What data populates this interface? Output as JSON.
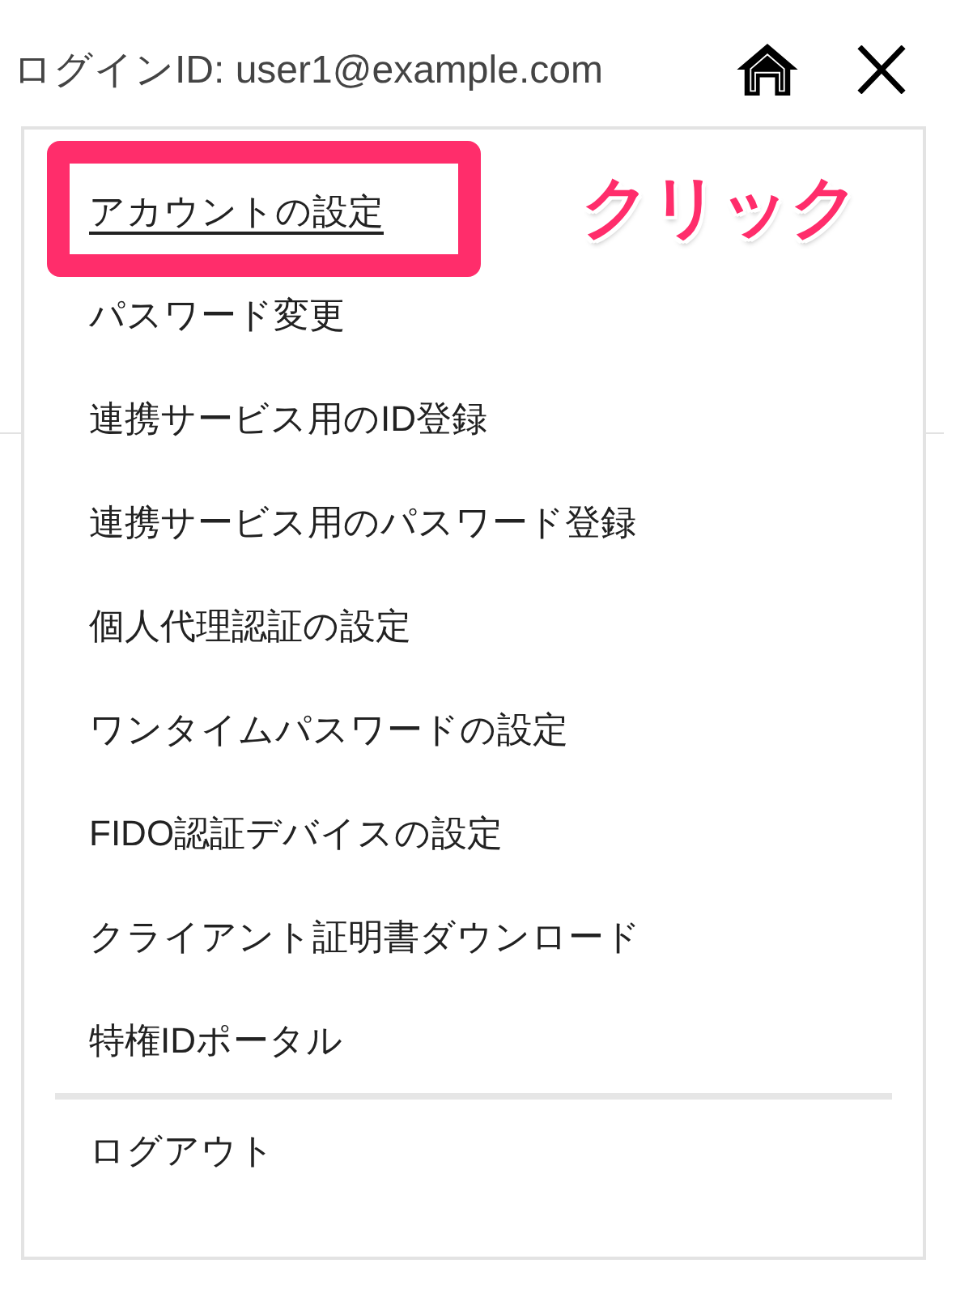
{
  "header": {
    "login_id": "ログインID: user1@example.com"
  },
  "menu": {
    "items": [
      {
        "label": "アカウントの設定",
        "highlighted": true
      },
      {
        "label": "パスワード変更",
        "highlighted": false
      },
      {
        "label": "連携サービス用のID登録",
        "highlighted": false
      },
      {
        "label": "連携サービス用のパスワード登録",
        "highlighted": false
      },
      {
        "label": "個人代理認証の設定",
        "highlighted": false
      },
      {
        "label": "ワンタイムパスワードの設定",
        "highlighted": false
      },
      {
        "label": "FIDO認証デバイスの設定",
        "highlighted": false
      },
      {
        "label": "クライアント証明書ダウンロード",
        "highlighted": false
      },
      {
        "label": "特権IDポータル",
        "highlighted": false
      }
    ],
    "footer_items": [
      {
        "label": "ログアウト"
      }
    ]
  },
  "annotation": {
    "label": "クリック"
  }
}
